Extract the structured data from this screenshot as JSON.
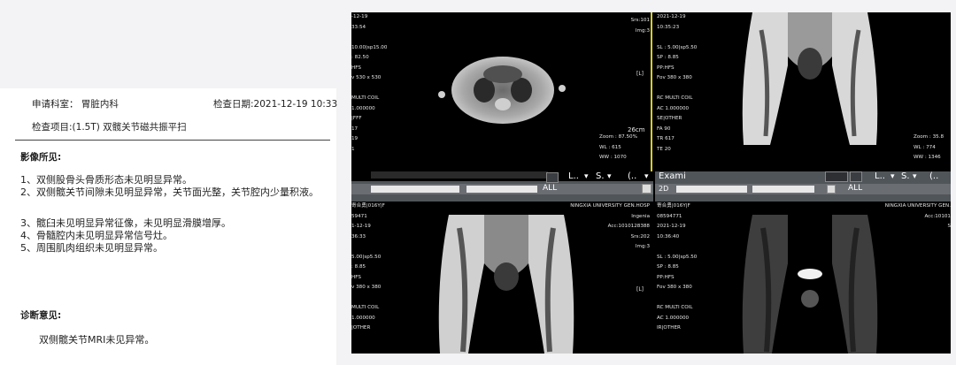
{
  "report": {
    "department": "申请科室：  胃脏内科",
    "exam_date": "检查日期:2021-12-19 10:33",
    "exam_item": "检查项目:(1.5T) 双髋关节磁共振平扫",
    "findings_title": "影像所见:",
    "findings": [
      "1、双侧股骨头骨质形态未见明显异常。",
      "2、双侧髋关节间隙未见明显异常，关节面光整，关节腔内少量积液。",
      "3、髋臼未见明显异常征像，未见明显滑膜增厚。",
      "4、骨髓腔内未见明显异常信号灶。",
      "5、周围肌肉组织未见明显异常。"
    ],
    "diagnosis_title": "诊断意见:",
    "diagnosis": "双侧髋关节MRI未见异常。"
  },
  "viewer": {
    "top_left": {
      "left_lines": [
        "-12-19",
        "33:54",
        "",
        "10.00|sp15.00",
        ": 82.50",
        "HFS",
        "v 530 x 530",
        "",
        "MULTI COIL",
        "1.000000",
        "|FFF",
        "17",
        "19",
        "1"
      ],
      "right_top": [
        "Srs:101",
        "Img:3"
      ],
      "marker": "[L]",
      "scale": "26cm",
      "bottom_right": [
        "Zoom : 87.50%",
        "WL : 615",
        "WW : 1070"
      ]
    },
    "top_right": {
      "left_lines": [
        "2021-12-19",
        "10:35:23",
        "",
        "SL : 5.00|sp5.50",
        "SP : 8.85",
        "PP:HFS",
        "Fov 380 x 380",
        "",
        "RC MULTI COIL",
        "AC 1.000000",
        "SE|OTHER",
        "FA 90",
        "TR 617",
        "TE 20"
      ],
      "bottom_right": [
        "Zoom : 35.8",
        "WL : 774",
        "WW : 1346"
      ]
    },
    "bottom_left": {
      "left_lines": [
        "寄合勇|016Y|F",
        "59471",
        "1-12-19",
        "36:33",
        "",
        "5.00|sp5.50",
        ": 8.85",
        "HFS",
        "v 380 x 380",
        "",
        "MULTI COIL",
        "1.000000",
        "|OTHER"
      ],
      "right_top": [
        "NINGXIA UNIVERSITY GEN.HOSP",
        "Ingenia",
        "Acc:1010128388",
        "Srs:202",
        "Img:3"
      ],
      "marker": "[L]"
    },
    "bottom_right": {
      "left_lines": [
        "寄合勇|016Y|F",
        "08594771",
        "2021-12-19",
        "10:36:40",
        "",
        "SL : 5.00|sp5.50",
        "SP : 8.85",
        "PP:HFS",
        "Fov 380 x 380",
        "",
        "RC MULTI COIL",
        "AC 1.000000",
        "IR|OTHER"
      ],
      "right_top": [
        "NINGXIA UNIVERSITY GEN.",
        "",
        "Acc:10101",
        "S"
      ]
    },
    "toolbar_left": {
      "menu1": "L..",
      "menu2": "S.",
      "menu3": "(..",
      "all_label": "ALL"
    },
    "toolbar_right": {
      "exam_label": "Exami",
      "mode": "2D",
      "menu1": "L..",
      "menu2": "S.",
      "menu3": "(..",
      "all_label": "ALL"
    }
  }
}
